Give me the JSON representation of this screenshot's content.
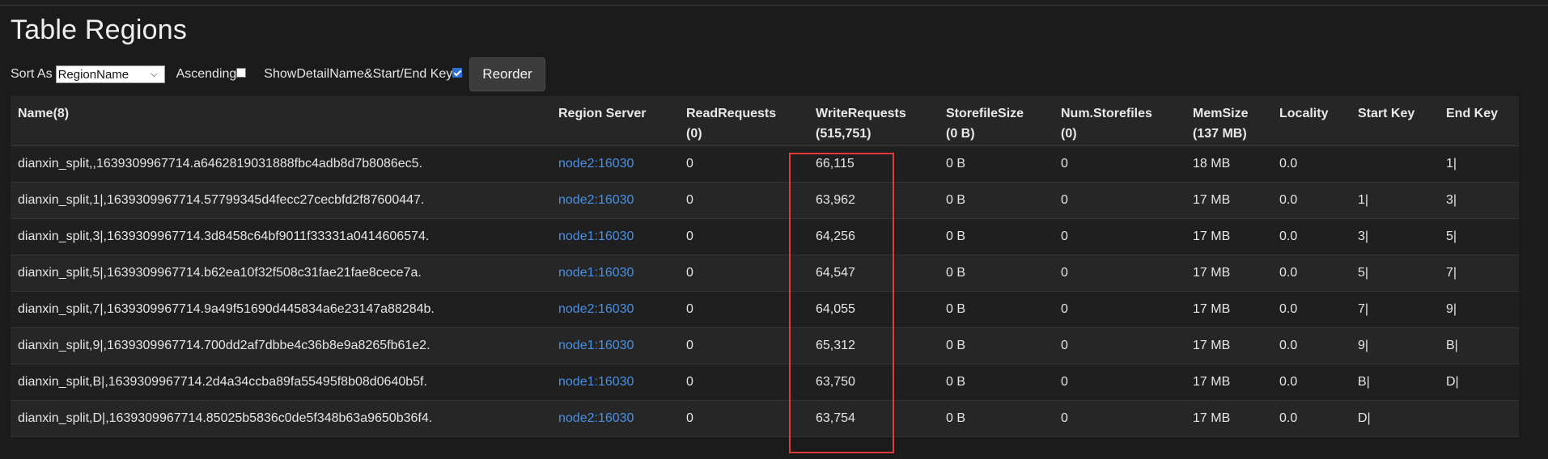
{
  "page": {
    "title": "Table Regions"
  },
  "controls": {
    "sort_as_label": "Sort As",
    "sort_value": "RegionName",
    "ascending_label": "Ascending",
    "ascending_checked": false,
    "show_detail_label": "ShowDetailName&Start/End Key",
    "show_detail_checked": true,
    "reorder_label": "Reorder"
  },
  "table": {
    "headers": [
      {
        "line1": "Name(8)",
        "line2": ""
      },
      {
        "line1": "Region Server",
        "line2": ""
      },
      {
        "line1": "ReadRequests",
        "line2": "(0)"
      },
      {
        "line1": "WriteRequests",
        "line2": "(515,751)"
      },
      {
        "line1": "StorefileSize",
        "line2": "(0 B)"
      },
      {
        "line1": "Num.Storefiles",
        "line2": "(0)"
      },
      {
        "line1": "MemSize",
        "line2": "(137 MB)"
      },
      {
        "line1": "Locality",
        "line2": ""
      },
      {
        "line1": "Start Key",
        "line2": ""
      },
      {
        "line1": "End Key",
        "line2": ""
      }
    ],
    "rows": [
      {
        "name": "dianxin_split,,1639309967714.a6462819031888fbc4adb8d7b8086ec5.",
        "server": "node2:16030",
        "read": "0",
        "write": "66,115",
        "storefile_size": "0 B",
        "num_storefiles": "0",
        "mem": "18 MB",
        "locality": "0.0",
        "start_key": "",
        "end_key": "1|"
      },
      {
        "name": "dianxin_split,1|,1639309967714.57799345d4fecc27cecbfd2f87600447.",
        "server": "node2:16030",
        "read": "0",
        "write": "63,962",
        "storefile_size": "0 B",
        "num_storefiles": "0",
        "mem": "17 MB",
        "locality": "0.0",
        "start_key": "1|",
        "end_key": "3|"
      },
      {
        "name": "dianxin_split,3|,1639309967714.3d8458c64bf9011f33331a0414606574.",
        "server": "node1:16030",
        "read": "0",
        "write": "64,256",
        "storefile_size": "0 B",
        "num_storefiles": "0",
        "mem": "17 MB",
        "locality": "0.0",
        "start_key": "3|",
        "end_key": "5|"
      },
      {
        "name": "dianxin_split,5|,1639309967714.b62ea10f32f508c31fae21fae8cece7a.",
        "server": "node1:16030",
        "read": "0",
        "write": "64,547",
        "storefile_size": "0 B",
        "num_storefiles": "0",
        "mem": "17 MB",
        "locality": "0.0",
        "start_key": "5|",
        "end_key": "7|"
      },
      {
        "name": "dianxin_split,7|,1639309967714.9a49f51690d445834a6e23147a88284b.",
        "server": "node2:16030",
        "read": "0",
        "write": "64,055",
        "storefile_size": "0 B",
        "num_storefiles": "0",
        "mem": "17 MB",
        "locality": "0.0",
        "start_key": "7|",
        "end_key": "9|"
      },
      {
        "name": "dianxin_split,9|,1639309967714.700dd2af7dbbe4c36b8e9a8265fb61e2.",
        "server": "node1:16030",
        "read": "0",
        "write": "65,312",
        "storefile_size": "0 B",
        "num_storefiles": "0",
        "mem": "17 MB",
        "locality": "0.0",
        "start_key": "9|",
        "end_key": "B|"
      },
      {
        "name": "dianxin_split,B|,1639309967714.2d4a34ccba89fa55495f8b08d0640b5f.",
        "server": "node1:16030",
        "read": "0",
        "write": "63,750",
        "storefile_size": "0 B",
        "num_storefiles": "0",
        "mem": "17 MB",
        "locality": "0.0",
        "start_key": "B|",
        "end_key": "D|"
      },
      {
        "name": "dianxin_split,D|,1639309967714.85025b5836c0de5f348b63a9650b36f4.",
        "server": "node2:16030",
        "read": "0",
        "write": "63,754",
        "storefile_size": "0 B",
        "num_storefiles": "0",
        "mem": "17 MB",
        "locality": "0.0",
        "start_key": "D|",
        "end_key": ""
      }
    ]
  },
  "colors": {
    "background": "#1b1b1b",
    "link": "#4a90e2",
    "highlight": "#e03a3a"
  }
}
